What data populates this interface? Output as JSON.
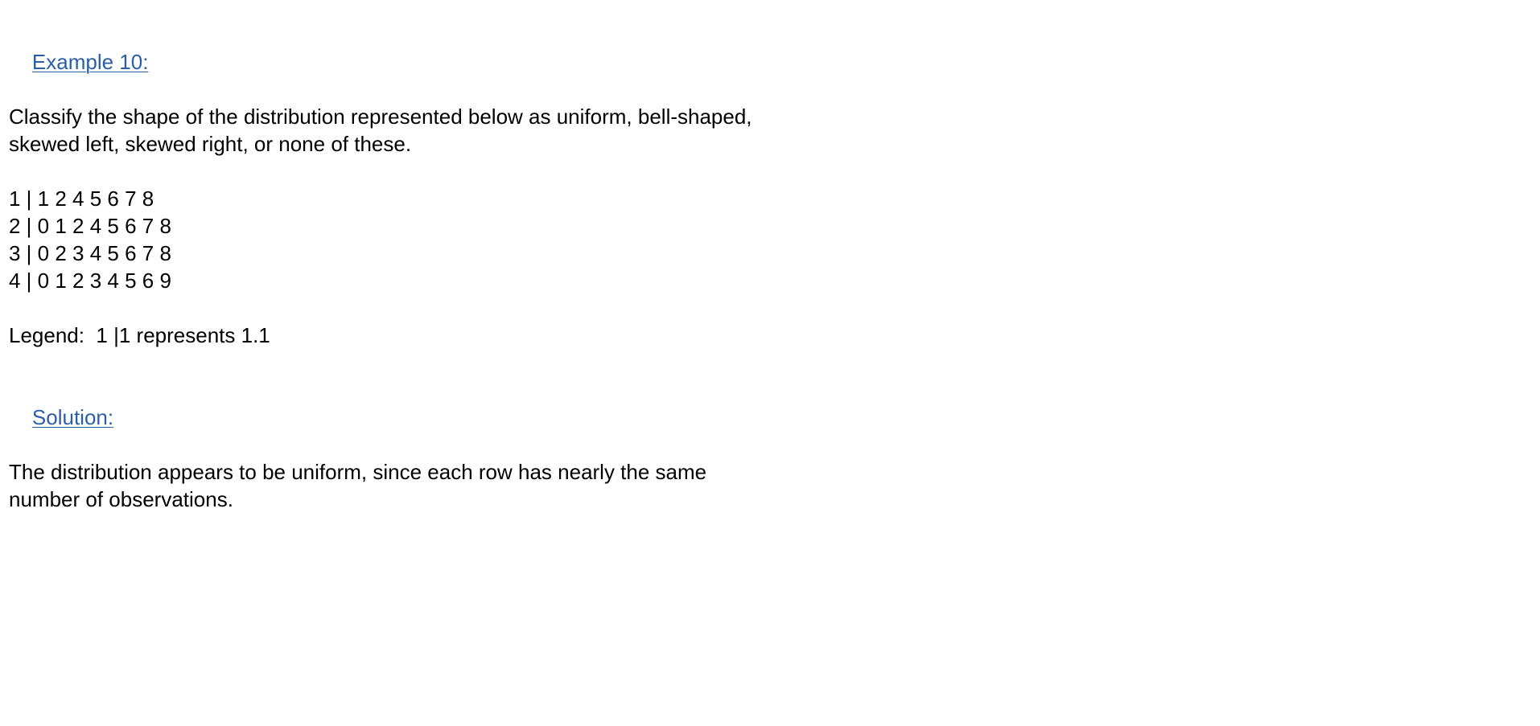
{
  "example": {
    "heading": "Example 10:",
    "question_lines": [
      "Classify the shape of the distribution represented below as uniform, bell-shaped,",
      "skewed left, skewed right, or none of these."
    ]
  },
  "stem_plot": {
    "rows": [
      "1 | 1 2 4 5 6 7 8",
      "2 | 0 1 2 4 5 6 7 8",
      "3 | 0 2 3 4 5 6 7 8",
      "4 | 0 1 2 3 4 5 6 9"
    ],
    "legend": "Legend:  1 |1 represents 1.1"
  },
  "solution": {
    "heading": "Solution:",
    "lines": [
      "The distribution appears to be uniform, since each row has nearly the same",
      "number of observations."
    ]
  },
  "colors": {
    "heading_link": "#2b5ea7",
    "text": "#000000",
    "background": "#ffffff"
  }
}
